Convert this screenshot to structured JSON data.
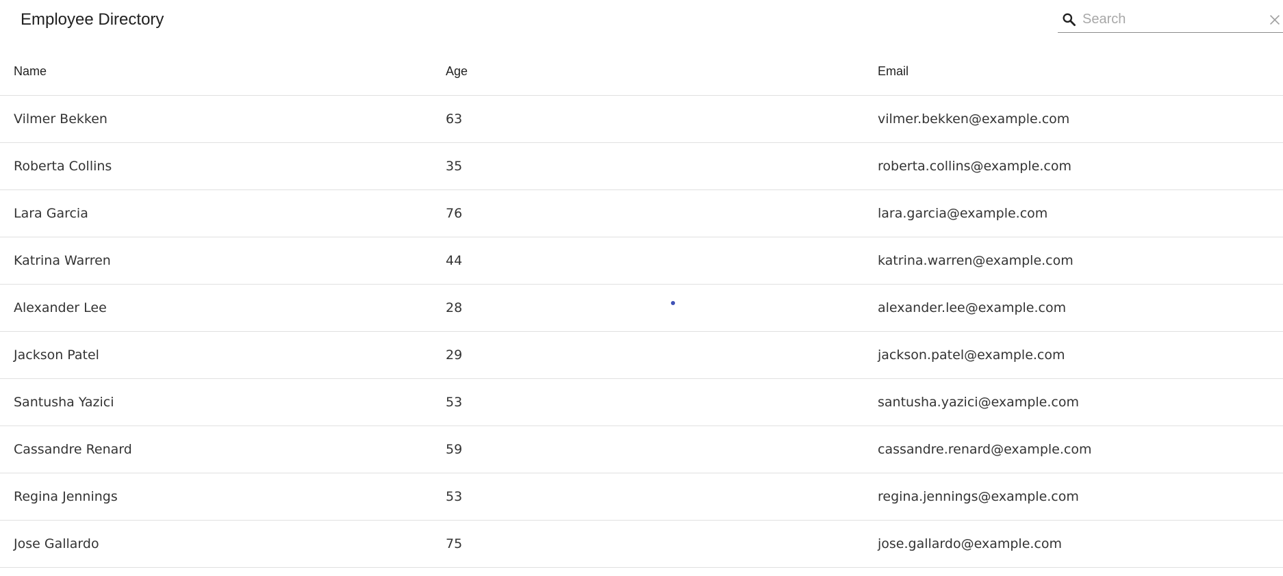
{
  "header": {
    "title": "Employee Directory"
  },
  "search": {
    "placeholder": "Search",
    "value": "",
    "icon": "search-icon",
    "clear_icon": "close-icon"
  },
  "table": {
    "columns": [
      "Name",
      "Age",
      "Email"
    ],
    "rows": [
      {
        "name": "Vilmer Bekken",
        "age": "63",
        "email": "vilmer.bekken@example.com"
      },
      {
        "name": "Roberta Collins",
        "age": "35",
        "email": "roberta.collins@example.com"
      },
      {
        "name": "Lara Garcia",
        "age": "76",
        "email": "lara.garcia@example.com"
      },
      {
        "name": "Katrina Warren",
        "age": "44",
        "email": "katrina.warren@example.com"
      },
      {
        "name": "Alexander Lee",
        "age": "28",
        "email": "alexander.lee@example.com"
      },
      {
        "name": "Jackson Patel",
        "age": "29",
        "email": "jackson.patel@example.com"
      },
      {
        "name": "Santusha Yazici",
        "age": "53",
        "email": "santusha.yazici@example.com"
      },
      {
        "name": "Cassandre Renard",
        "age": "59",
        "email": "cassandre.renard@example.com"
      },
      {
        "name": "Regina Jennings",
        "age": "53",
        "email": "regina.jennings@example.com"
      },
      {
        "name": "Jose Gallardo",
        "age": "75",
        "email": "jose.gallardo@example.com"
      }
    ]
  },
  "colors": {
    "text": "#212121",
    "row_border": "#e0e0e0",
    "accent": "#3f51b5",
    "placeholder": "#a8a8a8"
  }
}
